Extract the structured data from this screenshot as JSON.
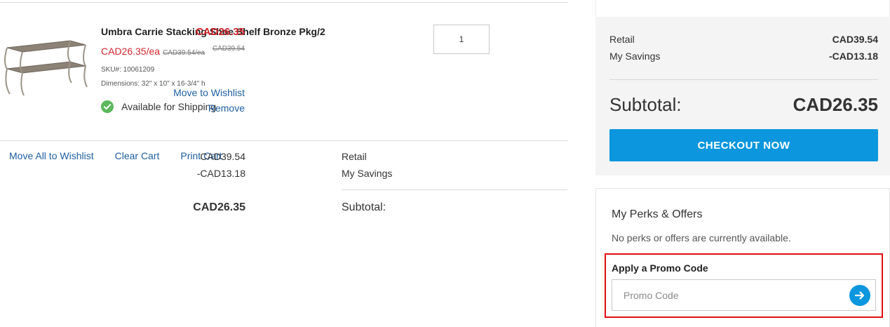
{
  "item": {
    "name": "Umbra Carrie Stacking Shoe Shelf Bronze Pkg/2",
    "unit_price": "CAD26.35/ea",
    "unit_price_original": "CAD39.54/ea",
    "sku": "SKU#: 10061209",
    "dimensions": "Dimensions: 32\" x 10\" x 16-3/4\" h",
    "availability": "Available for Shipping",
    "quantity": "1",
    "line_total": "CAD26.35",
    "line_total_original": "CAD39.54",
    "move_to_wishlist": "Move to Wishlist",
    "remove": "Remove"
  },
  "cart_actions": {
    "move_all": "Move All to Wishlist",
    "clear": "Clear Cart",
    "print": "Print Cart"
  },
  "summary": {
    "retail_label": "Retail",
    "retail_value": "CAD39.54",
    "savings_label": "My Savings",
    "savings_value": "-CAD13.18",
    "subtotal_label": "Subtotal:",
    "subtotal_value": "CAD26.35"
  },
  "order_panel": {
    "retail_label": "Retail",
    "retail_value": "CAD39.54",
    "savings_label": "My Savings",
    "savings_value": "-CAD13.18",
    "subtotal_label": "Subtotal:",
    "subtotal_value": "CAD26.35",
    "checkout_label": "CHECKOUT NOW"
  },
  "perks": {
    "title": "My Perks & Offers",
    "empty_message": "No perks or offers are currently available.",
    "promo_label": "Apply a Promo Code",
    "promo_placeholder": "Promo Code"
  },
  "colors": {
    "sale_red": "#d0262d",
    "link_blue": "#1f5fa0",
    "accent_blue": "#0b96de",
    "available_green": "#5cb85c",
    "highlight_red": "#e10e0e"
  },
  "icons": {
    "availability": "check-circle-icon",
    "promo_submit": "arrow-right-icon"
  }
}
